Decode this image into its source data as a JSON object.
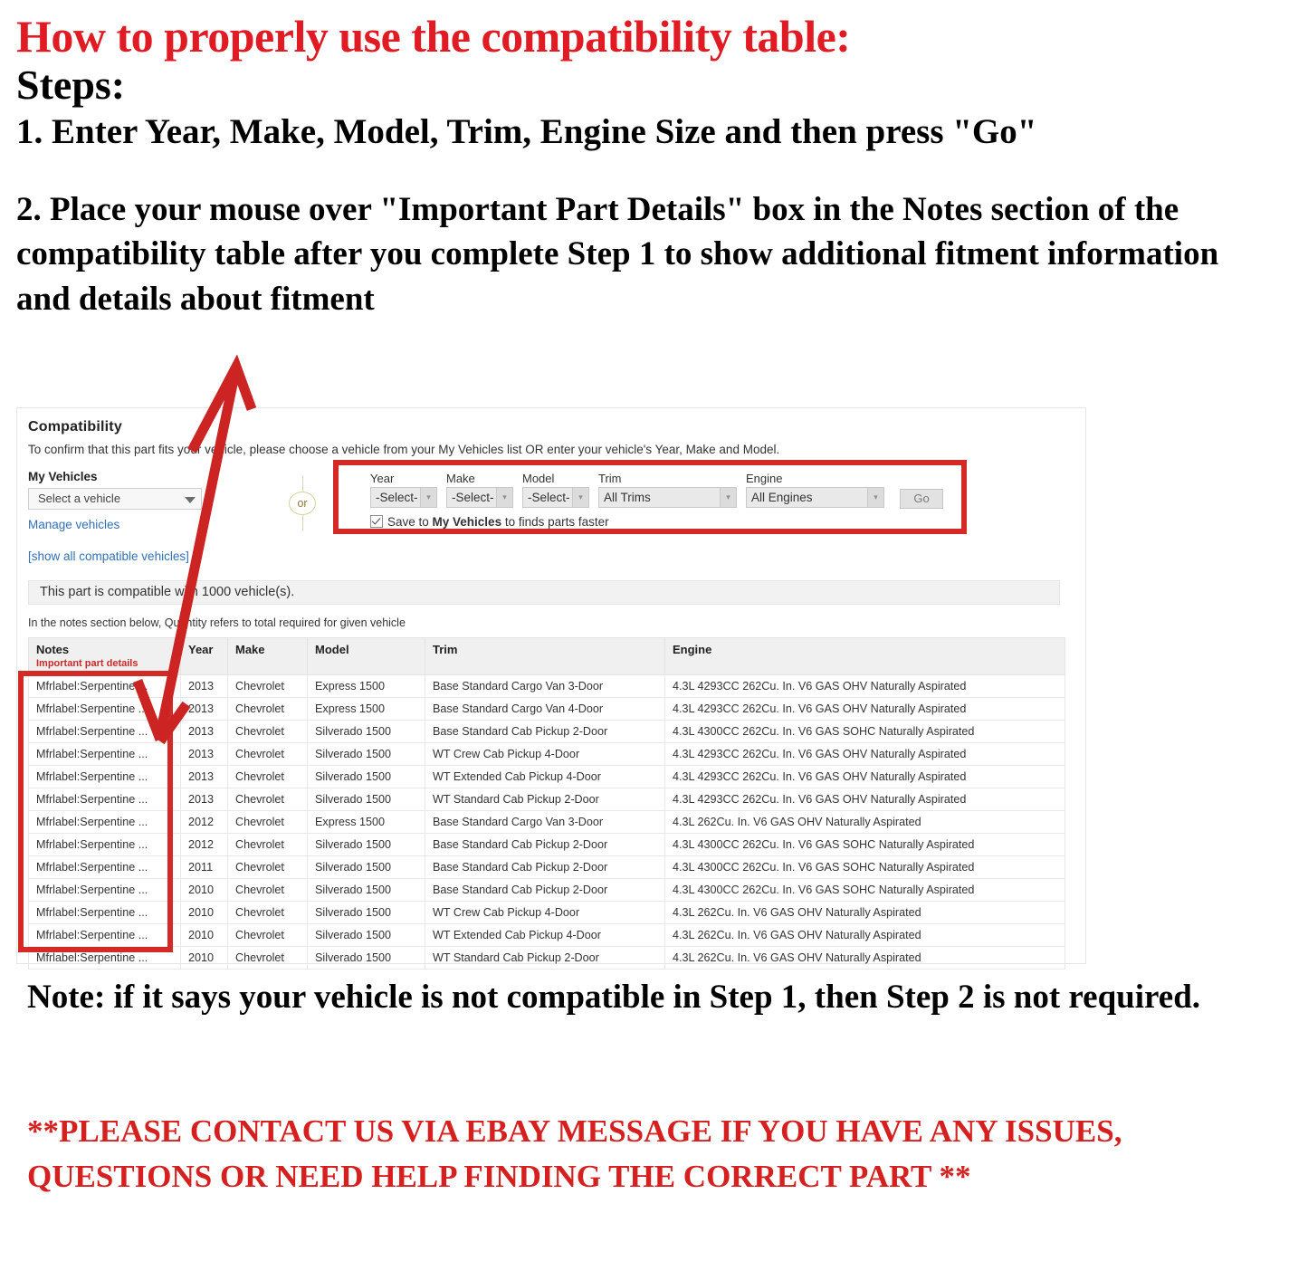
{
  "instructions": {
    "headline": "How to properly use the compatibility table:",
    "steps_label": "Steps:",
    "step1": "1. Enter Year, Make, Model, Trim, Engine Size and then press \"Go\"",
    "step2": "2. Place your mouse over \"Important Part Details\" box in the Notes section of the compatibility table after you complete Step 1 to show additional fitment information and details about fitment",
    "bottom_note": "Note: if it says your vehicle is not compatible in Step 1, then Step 2 is not required.",
    "contact_note": "**PLEASE CONTACT US VIA EBAY MESSAGE IF YOU HAVE ANY ISSUES, QUESTIONS OR NEED HELP FINDING THE CORRECT PART **"
  },
  "colors": {
    "headline_red": "#e01b24",
    "highlight_red": "#d32a27",
    "link_blue": "#3270b5",
    "notes_accent_red": "#cc2a27"
  },
  "compatibility": {
    "title": "Compatibility",
    "subtitle": "To confirm that this part fits your vehicle, please choose a vehicle from your My Vehicles list OR enter your vehicle's Year, Make and Model.",
    "my_vehicles_label": "My Vehicles",
    "vehicle_select_value": "Select a vehicle",
    "manage_vehicles_link": "Manage vehicles",
    "show_all_link": "[show all compatible vehicles]",
    "or_label": "or",
    "finder": {
      "year_label": "Year",
      "year_value": "-Select-",
      "make_label": "Make",
      "make_value": "-Select-",
      "model_label": "Model",
      "model_value": "-Select-",
      "trim_label": "Trim",
      "trim_value": "All Trims",
      "engine_label": "Engine",
      "engine_value": "All Engines",
      "go_label": "Go",
      "save_text_pre": "Save to ",
      "save_text_bold": "My Vehicles",
      "save_text_post": " to finds parts faster"
    },
    "count_bar": "This part is compatible with 1000 vehicle(s).",
    "notes_hint": "In the notes section below, Quantity refers to total required for given vehicle",
    "table": {
      "headers": {
        "notes": "Notes",
        "notes_sub": "Important part details",
        "year": "Year",
        "make": "Make",
        "model": "Model",
        "trim": "Trim",
        "engine": "Engine"
      },
      "rows": [
        {
          "notes": "Mfrlabel:Serpentine ...",
          "year": "2013",
          "make": "Chevrolet",
          "model": "Express 1500",
          "trim": "Base Standard Cargo Van 3-Door",
          "engine": "4.3L 4293CC 262Cu. In. V6 GAS OHV Naturally Aspirated"
        },
        {
          "notes": "Mfrlabel:Serpentine ...",
          "year": "2013",
          "make": "Chevrolet",
          "model": "Express 1500",
          "trim": "Base Standard Cargo Van 4-Door",
          "engine": "4.3L 4293CC 262Cu. In. V6 GAS OHV Naturally Aspirated"
        },
        {
          "notes": "Mfrlabel:Serpentine ...",
          "year": "2013",
          "make": "Chevrolet",
          "model": "Silverado 1500",
          "trim": "Base Standard Cab Pickup 2-Door",
          "engine": "4.3L 4300CC 262Cu. In. V6 GAS SOHC Naturally Aspirated"
        },
        {
          "notes": "Mfrlabel:Serpentine ...",
          "year": "2013",
          "make": "Chevrolet",
          "model": "Silverado 1500",
          "trim": "WT Crew Cab Pickup 4-Door",
          "engine": "4.3L 4293CC 262Cu. In. V6 GAS OHV Naturally Aspirated"
        },
        {
          "notes": "Mfrlabel:Serpentine ...",
          "year": "2013",
          "make": "Chevrolet",
          "model": "Silverado 1500",
          "trim": "WT Extended Cab Pickup 4-Door",
          "engine": "4.3L 4293CC 262Cu. In. V6 GAS OHV Naturally Aspirated"
        },
        {
          "notes": "Mfrlabel:Serpentine ...",
          "year": "2013",
          "make": "Chevrolet",
          "model": "Silverado 1500",
          "trim": "WT Standard Cab Pickup 2-Door",
          "engine": "4.3L 4293CC 262Cu. In. V6 GAS OHV Naturally Aspirated"
        },
        {
          "notes": "Mfrlabel:Serpentine ...",
          "year": "2012",
          "make": "Chevrolet",
          "model": "Express 1500",
          "trim": "Base Standard Cargo Van 3-Door",
          "engine": "4.3L 262Cu. In. V6 GAS OHV Naturally Aspirated"
        },
        {
          "notes": "Mfrlabel:Serpentine ...",
          "year": "2012",
          "make": "Chevrolet",
          "model": "Silverado 1500",
          "trim": "Base Standard Cab Pickup 2-Door",
          "engine": "4.3L 4300CC 262Cu. In. V6 GAS SOHC Naturally Aspirated"
        },
        {
          "notes": "Mfrlabel:Serpentine ...",
          "year": "2011",
          "make": "Chevrolet",
          "model": "Silverado 1500",
          "trim": "Base Standard Cab Pickup 2-Door",
          "engine": "4.3L 4300CC 262Cu. In. V6 GAS SOHC Naturally Aspirated"
        },
        {
          "notes": "Mfrlabel:Serpentine ...",
          "year": "2010",
          "make": "Chevrolet",
          "model": "Silverado 1500",
          "trim": "Base Standard Cab Pickup 2-Door",
          "engine": "4.3L 4300CC 262Cu. In. V6 GAS SOHC Naturally Aspirated"
        },
        {
          "notes": "Mfrlabel:Serpentine ...",
          "year": "2010",
          "make": "Chevrolet",
          "model": "Silverado 1500",
          "trim": "WT Crew Cab Pickup 4-Door",
          "engine": "4.3L 262Cu. In. V6 GAS OHV Naturally Aspirated"
        },
        {
          "notes": "Mfrlabel:Serpentine ...",
          "year": "2010",
          "make": "Chevrolet",
          "model": "Silverado 1500",
          "trim": "WT Extended Cab Pickup 4-Door",
          "engine": "4.3L 262Cu. In. V6 GAS OHV Naturally Aspirated"
        },
        {
          "notes": "Mfrlabel:Serpentine ...",
          "year": "2010",
          "make": "Chevrolet",
          "model": "Silverado 1500",
          "trim": "WT Standard Cab Pickup 2-Door",
          "engine": "4.3L 262Cu. In. V6 GAS OHV Naturally Aspirated"
        }
      ]
    }
  }
}
